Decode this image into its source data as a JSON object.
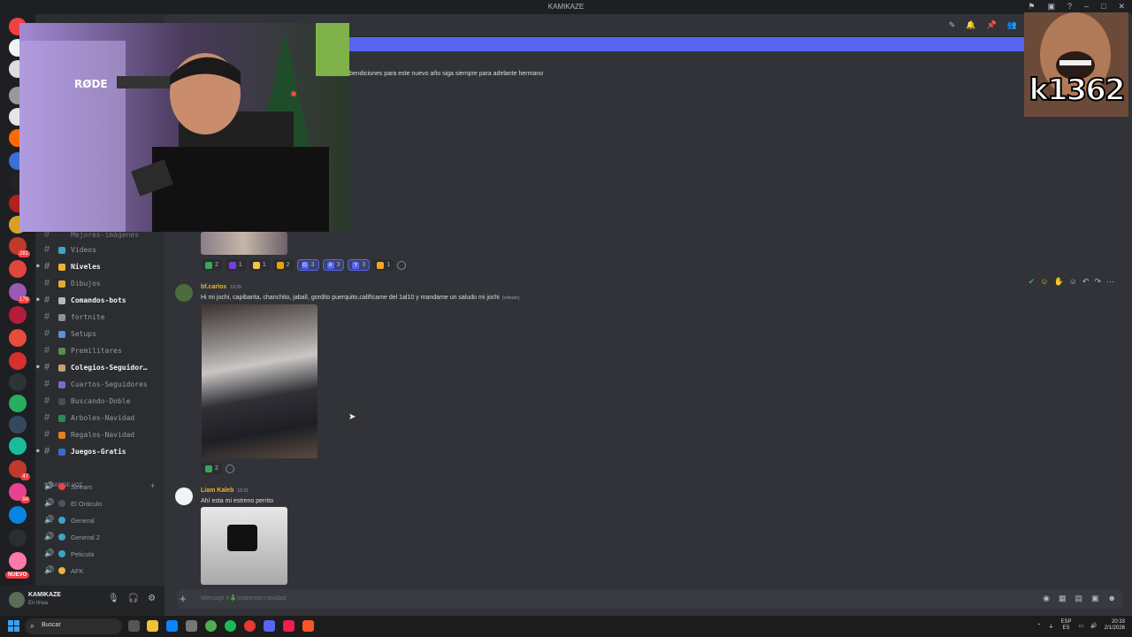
{
  "window": {
    "title": "KAMIKAZE"
  },
  "servers": {
    "badges": [
      "281",
      "179",
      "47",
      "94"
    ],
    "nuevo_label": "NUEVO"
  },
  "channels": {
    "partial_top": "Mejores-imágenes",
    "items": [
      {
        "label": "Videos",
        "bold": false,
        "arrow": false
      },
      {
        "label": "Niveles",
        "bold": true,
        "arrow": true
      },
      {
        "label": "Dibujos",
        "bold": false,
        "arrow": false
      },
      {
        "label": "Comandos-bots",
        "bold": true,
        "arrow": true
      },
      {
        "label": "fortnite",
        "bold": false,
        "arrow": false
      },
      {
        "label": "Setups",
        "bold": false,
        "arrow": false
      },
      {
        "label": "Premilitares",
        "bold": false,
        "arrow": false
      },
      {
        "label": "Colegios-Seguidor…",
        "bold": true,
        "arrow": true
      },
      {
        "label": "Cuartos-Seguidores",
        "bold": false,
        "arrow": false
      },
      {
        "label": "Buscando-Doble",
        "bold": false,
        "arrow": false
      },
      {
        "label": "Arboles-Navidad",
        "bold": false,
        "arrow": false
      },
      {
        "label": "Regalos-Navidad",
        "bold": false,
        "arrow": false
      },
      {
        "label": "Juegos-Gratis",
        "bold": true,
        "arrow": true
      }
    ],
    "voice_category": "SALAS DE VOZ",
    "voice": [
      {
        "label": "Stream"
      },
      {
        "label": "El Oráculo"
      },
      {
        "label": "General"
      },
      {
        "label": "General 2"
      },
      {
        "label": "Pelicula"
      },
      {
        "label": "AFK"
      }
    ]
  },
  "user": {
    "name": "KAMIKAZE",
    "status": "En línea"
  },
  "messages": {
    "top_line": "bendiciones para este nuevo año siga siempre para adelante hermano",
    "first_reactions": [
      {
        "count": "2",
        "color": "#3ba55c",
        "mine": false
      },
      {
        "count": "1",
        "color": "#7c3aed",
        "mine": false
      },
      {
        "count": "1",
        "color": "#f5c542",
        "mine": false
      },
      {
        "count": "2",
        "color": "#e5a50a",
        "mine": false
      },
      {
        "count": "3",
        "color": "#5865f2",
        "mine": true,
        "letter": "G"
      },
      {
        "count": "3",
        "color": "#5865f2",
        "mine": true,
        "letter": "A"
      },
      {
        "count": "3",
        "color": "#5865f2",
        "mine": true,
        "letter": "Y"
      },
      {
        "count": "1",
        "color": "#f5a623",
        "mine": false
      }
    ],
    "msg1": {
      "author": "bf.carlos",
      "time": "19:29",
      "text": "Hi mi jochi, capibarita, chanchito, jabalí, gordito puerquito,califícame del 1al10 y mandame un saludo mi jochi",
      "edited": "(editado)",
      "reaction_count": "2"
    },
    "msg2": {
      "author": "Liam Kaleb",
      "time": "19:31",
      "text": "Ahí esta mi estreno perrito"
    }
  },
  "input": {
    "placeholder": "Mensaje #🎄|estrenos-navidad"
  },
  "taskbar": {
    "search": "Buscar",
    "lang": "ESP",
    "lang2": "ES",
    "time": "20:33",
    "date": "2/1/2026"
  },
  "overlay": {
    "tag": "k1362",
    "rode": "RØDE"
  },
  "colors": {
    "accent": "#5865f2",
    "bg": "#313338",
    "sidebar": "#2b2d31",
    "rail": "#1e1f22"
  }
}
